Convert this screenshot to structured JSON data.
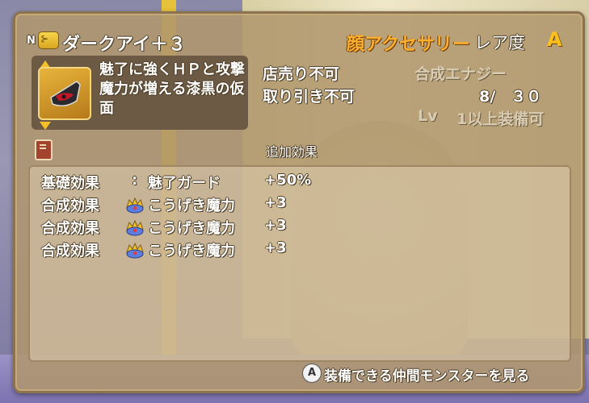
{
  "item": {
    "prefix_badge": "N",
    "name": "ダークアイ＋３",
    "category": "顔アクセサリー",
    "rarity_label": "レア度",
    "rarity_value": "A",
    "description": "魅了に強くＨＰと攻撃魔力が増える漆黒の仮面",
    "icon": "dark-mask-icon"
  },
  "stats": {
    "sell": "店売り不可",
    "trade": "取り引き不可",
    "synth_energy_label": "合成エナジー",
    "synth_energy_value": "8/　３０",
    "level_req_label": "Lv",
    "level_req_value": "1以上装備可"
  },
  "effects": {
    "section_title": "追加効果",
    "rows": [
      {
        "label": "基礎効果",
        "name": "魅了ガード",
        "value": "+50%",
        "icon": ""
      },
      {
        "label": "合成効果",
        "name": "こうげき魔力",
        "value": "+3",
        "icon": "crown-gem-icon"
      },
      {
        "label": "合成効果",
        "name": "こうげき魔力",
        "value": "+3",
        "icon": "crown-gem-icon"
      },
      {
        "label": "合成効果",
        "name": "こうげき魔力",
        "value": "+3",
        "icon": "crown-gem-icon"
      }
    ]
  },
  "footer": {
    "button": "A",
    "text": "装備できる仲間モンスターを見る"
  },
  "colors": {
    "category": "#ffb030",
    "rarity": "#ffc21a",
    "panel": "#b0966c"
  }
}
